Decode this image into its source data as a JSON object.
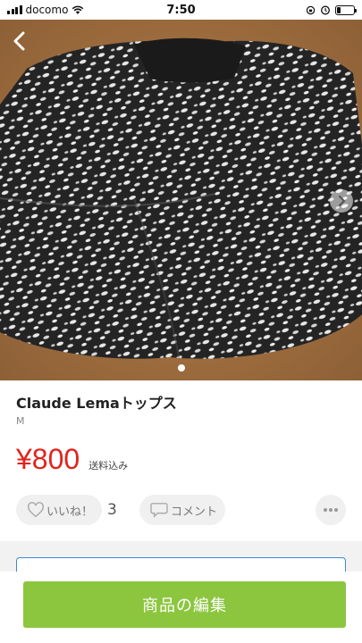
{
  "status_bar": {
    "carrier": "docomo",
    "time": "7:50",
    "battery_level": 0.2
  },
  "product": {
    "title": "Claude Lemaトップス",
    "size": "M",
    "price": "¥800",
    "shipping": "送料込み",
    "image_count": 1,
    "current_image": 1
  },
  "actions": {
    "like_label": "いいね！",
    "like_count": "3",
    "comment_label": "コメント"
  },
  "footer": {
    "edit_label": "商品の編集"
  },
  "colors": {
    "price": "#e0241c",
    "edit_button": "#8cc63f",
    "card_border": "#3b8ad6"
  },
  "icons": [
    "back-arrow-icon",
    "next-arrow-icon",
    "heart-icon",
    "comment-bubble-icon",
    "more-dots-icon",
    "wifi-icon",
    "alarm-icon",
    "battery-icon"
  ]
}
